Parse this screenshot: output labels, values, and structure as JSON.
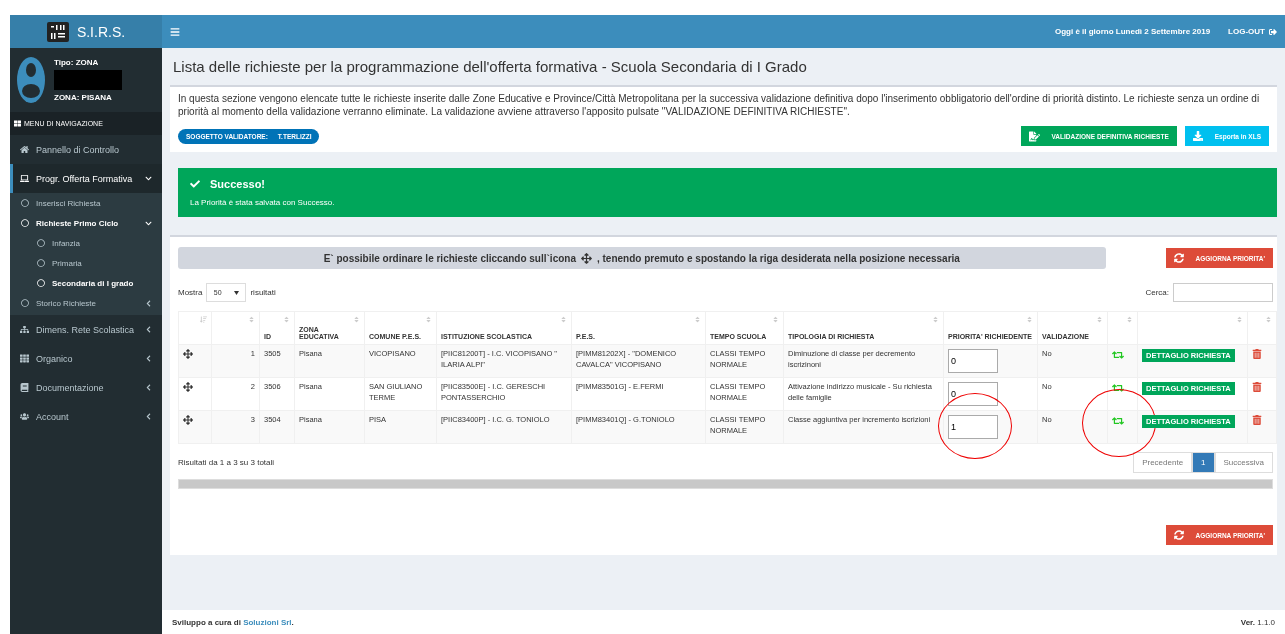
{
  "logo": {
    "title": "S.I.R.S."
  },
  "topbar": {
    "date": "Oggi è il giorno Lunedì 2 Settembre 2019",
    "logout": "LOG-OUT"
  },
  "user": {
    "type": "Tipo: ZONA",
    "zone": "ZONA: PISANA"
  },
  "sidebar": {
    "header": "MENU DI NAVIGAZIONE",
    "items": [
      {
        "label": "Pannello di Controllo",
        "selected": false
      },
      {
        "label": "Progr. Offerta Formativa",
        "selected": true,
        "expanded": true,
        "children": [
          {
            "label": "Inserisci Richiesta",
            "selected": false
          },
          {
            "label": "Richieste Primo Ciclo",
            "selected": true,
            "expanded": true,
            "children": [
              {
                "label": "Infanzia",
                "selected": false
              },
              {
                "label": "Primaria",
                "selected": false
              },
              {
                "label": "Secondaria di I grado",
                "selected": true
              }
            ]
          },
          {
            "label": "Storico Richieste",
            "selected": false,
            "expanded": false
          }
        ]
      },
      {
        "label": "Dimens. Rete Scolastica",
        "selected": false,
        "expanded": false
      },
      {
        "label": "Organico",
        "selected": false,
        "expanded": false
      },
      {
        "label": "Documentazione",
        "selected": false,
        "expanded": false
      },
      {
        "label": "Account",
        "selected": false,
        "expanded": false
      }
    ]
  },
  "page_title": "Lista delle richieste per la programmazione dell'offerta formativa - Scuola Secondaria di I Grado",
  "info": {
    "text": "In questa sezione vengono elencate tutte le richieste inserite dalle Zone Educative e Province/Città Metropolitana per la successiva validazione definitiva dopo l'inserimento obbligatorio dell'ordine di priorità distinto. Le richieste senza un ordine di priorità al momento della validazione verranno eliminate. La validazione avviene attraverso l'apposito pulsate \"VALIDAZIONE DEFINITIVA RICHIESTE\".",
    "validator_label": "SOGGETTO VALIDATORE:",
    "validator": "T.TERLIZZI",
    "buttons": [
      {
        "kind": "validate",
        "label": "VALIDAZIONE DEFINITIVA RICHIESTE"
      },
      {
        "kind": "export",
        "label": "Esporta in XLS"
      }
    ]
  },
  "alert": {
    "title": "Successo!",
    "message": "La Priorità è stata salvata con Successo."
  },
  "instruction": {
    "before": "E` possibile ordinare le richieste cliccando sull`icona",
    "after": ", tenendo premuto e spostando la riga desiderata nella posizione necessaria"
  },
  "update_buttons": [
    "AGGIORNA PRIORITA'",
    "AGGIORNA PRIORITA'"
  ],
  "length": {
    "before": "Mostra",
    "value": "50",
    "after": "risultati"
  },
  "search": {
    "label": "Cerca:"
  },
  "table": {
    "columns": [
      "",
      "",
      "ID",
      "ZONA EDUCATIVA",
      "COMUNE P.E.S.",
      "ISTITUZIONE SCOLASTICA",
      "P.E.S.",
      "TEMPO SCUOLA",
      "TIPOLOGIA DI RICHIESTA",
      "PRIORITA' RICHIEDENTE",
      "VALIDAZIONE",
      "",
      "",
      ""
    ],
    "rows": [
      {
        "num": "1",
        "id": "3505",
        "zona": "Pisana",
        "comune": "VICOPISANO",
        "istituzione": "[PIIC81200T] - I.C. VICOPISANO \" ILARIA ALPI\"",
        "pes": "[PIMM81202X] - \"DOMENICO CAVALCA\" VICOPISANO",
        "tempo": "CLASSI TEMPO NORMALE",
        "tipologia": "Diminuzione di classe per decremento iscrizinoni",
        "priorita": "0",
        "validazione": "No",
        "detail": "DETTAGLIO RICHIESTA",
        "circled": false
      },
      {
        "num": "2",
        "id": "3506",
        "zona": "Pisana",
        "comune": "SAN GIULIANO TERME",
        "istituzione": "[PIIC83500E] - I.C. GERESCHI PONTASSERCHIO",
        "pes": "[PIMM83501G] - E.FERMI",
        "tempo": "CLASSI TEMPO NORMALE",
        "tipologia": "Attivazione indirizzo musicale - Su richiesta delle famiglie",
        "priorita": "0",
        "validazione": "No",
        "detail": "DETTAGLIO RICHIESTA",
        "circled": false
      },
      {
        "num": "3",
        "id": "3504",
        "zona": "Pisana",
        "comune": "PISA",
        "istituzione": "[PIIC83400P] - I.C. G. TONIOLO",
        "pes": "[PIMM83401Q] - G.TONIOLO",
        "tempo": "CLASSI TEMPO NORMALE",
        "tipologia": "Classe aggiuntiva per incremento iscrizioni",
        "priorita": "1",
        "validazione": "No",
        "detail": "DETTAGLIO RICHIESTA",
        "circled": true
      }
    ]
  },
  "summary": "Risultati da 1 a 3 su 3 totali",
  "pagination": [
    {
      "label": "Precedente",
      "selected": false
    },
    {
      "label": "1",
      "selected": true
    },
    {
      "label": "Successiva",
      "selected": false
    }
  ],
  "footer": {
    "before": "Sviluppo a cura di",
    "link": "Soluzioni Srl",
    "after": ".",
    "version": "**Ver.** 1.1.0"
  }
}
